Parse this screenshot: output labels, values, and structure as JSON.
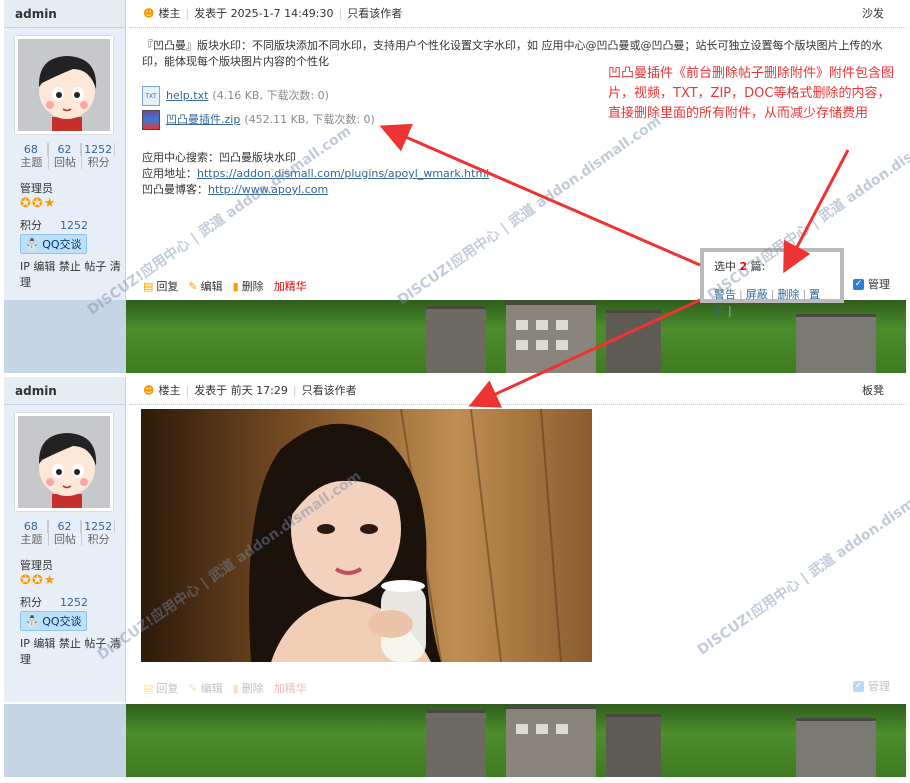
{
  "post1": {
    "username": "admin",
    "stats": [
      {
        "num": "68",
        "label": "主题"
      },
      {
        "num": "62",
        "label": "回帖"
      },
      {
        "num": "1252",
        "label": "积分"
      }
    ],
    "role": "管理员",
    "score_label": "积分",
    "score_value": "1252",
    "qq_label": "QQ交谈",
    "admin_links": "IP 编辑 禁止 帖子 清理",
    "floor_owner": "楼主",
    "posted": "发表于 2025-1-7 14:49:30",
    "author_only": "只看该作者",
    "floor": "沙发",
    "body": "『凹凸曼』版块水印：不同版块添加不同水印，支持用户个性化设置文字水印，如 应用中心@凹凸曼或@凹凸曼；站长可独立设置每个版块图片上传的水印，能体现每个版块图片内容的个性化",
    "attachments": [
      {
        "name": "help.txt",
        "meta": "(4.16 KB, 下载次数: 0)"
      },
      {
        "name": "凹凸曼插件.zip",
        "meta": "(452.11 KB, 下载次数: 0)"
      }
    ],
    "search_line": "应用中心搜索：凹凸曼版块水印",
    "app_label": "应用地址：",
    "app_url": "https://addon.dismall.com/plugins/apoyl_wmark.html",
    "blog_label": "凹凸曼博客：",
    "blog_url": "http://www.apoyl.com",
    "actions": {
      "reply": "回复",
      "edit": "编辑",
      "delete": "删除",
      "digest": "加精华"
    },
    "manage": "管理"
  },
  "post2": {
    "username": "admin",
    "stats": [
      {
        "num": "68",
        "label": "主题"
      },
      {
        "num": "62",
        "label": "回帖"
      },
      {
        "num": "1252",
        "label": "积分"
      }
    ],
    "role": "管理员",
    "score_label": "积分",
    "score_value": "1252",
    "qq_label": "QQ交谈",
    "admin_links": "IP 编辑 禁止 帖子 清理",
    "floor_owner": "楼主",
    "posted": "发表于 前天 17:29",
    "author_only": "只看该作者",
    "floor": "板凳",
    "actions": {
      "reply": "回复",
      "edit": "编辑",
      "delete": "删除",
      "digest": "加精华"
    },
    "manage": "管理"
  },
  "selection": {
    "prefix": "选中",
    "count": "2",
    "suffix": "篇:",
    "actions": [
      "警告",
      "屏蔽",
      "删除",
      "置顶"
    ]
  },
  "annotation": "凹凸曼插件《前台删除帖子删除附件》附件包含图片，视频，TXT，ZIP，DOC等格式删除的内容，直接删除里面的所有附件，从而减少存储费用",
  "watermark": "DISCUZ!应用中心 | 武道 addon.dismall.com",
  "colors": {
    "accent_red": "#e33333",
    "link": "#336699",
    "sidebar": "#e8eef7"
  }
}
